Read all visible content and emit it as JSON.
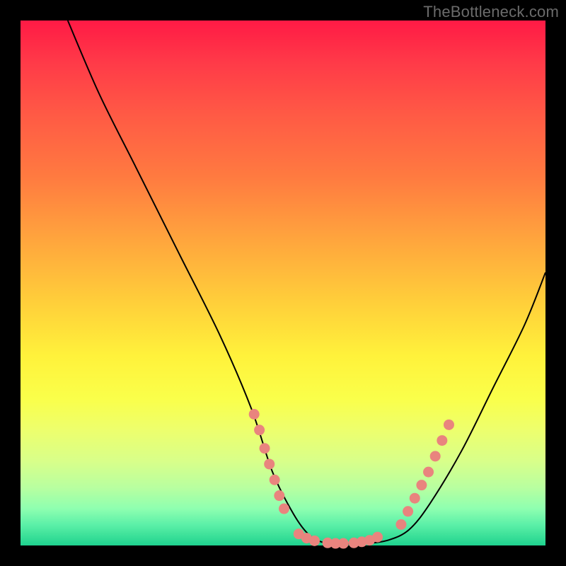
{
  "watermark": "TheBottleneck.com",
  "chart_data": {
    "type": "line",
    "title": "",
    "xlabel": "",
    "ylabel": "",
    "xlim": [
      0,
      100
    ],
    "ylim": [
      0,
      100
    ],
    "series": [
      {
        "name": "curve",
        "style": "line-black",
        "x": [
          9,
          15,
          22,
          30,
          38,
          44,
          48,
          52,
          55,
          58,
          62,
          66,
          70,
          74,
          78,
          84,
          90,
          96,
          100
        ],
        "y": [
          100,
          86,
          72,
          56,
          40,
          26,
          14,
          6,
          2,
          0.5,
          0.3,
          0.4,
          1,
          3,
          8,
          18,
          30,
          42,
          52
        ]
      },
      {
        "name": "dots-left-descent",
        "style": "dots-salmon",
        "x": [
          44.5,
          45.5,
          46.5,
          47.4,
          48.4,
          49.3,
          50.2
        ],
        "y": [
          25,
          22,
          18.5,
          15.5,
          12.5,
          9.5,
          7
        ]
      },
      {
        "name": "dots-bottom",
        "style": "dots-salmon",
        "x": [
          53,
          54.5,
          56,
          58.5,
          60,
          61.5,
          63.5,
          65,
          66.5,
          68
        ],
        "y": [
          2.2,
          1.4,
          0.9,
          0.5,
          0.4,
          0.4,
          0.5,
          0.7,
          1.0,
          1.6
        ]
      },
      {
        "name": "dots-right-ascent",
        "style": "dots-salmon",
        "x": [
          72.5,
          73.8,
          75.1,
          76.4,
          77.7,
          79,
          80.3,
          81.6
        ],
        "y": [
          4,
          6.5,
          9,
          11.5,
          14,
          17,
          20,
          23
        ]
      }
    ],
    "colors": {
      "curve": "#000000",
      "dots": "#e9847e",
      "bg_top": "#ff1a45",
      "bg_bottom": "#1fd28f"
    }
  }
}
